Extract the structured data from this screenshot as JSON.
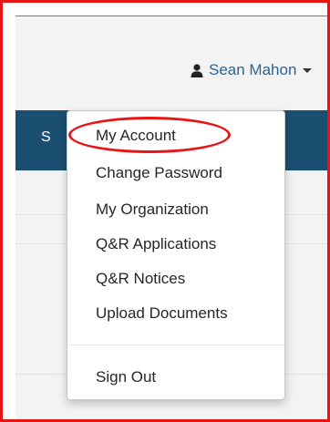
{
  "header": {
    "user_name": "Sean Mahon",
    "navbar_fragment": "S"
  },
  "icons": {
    "user": "user-icon",
    "caret": "chevron-down-icon"
  },
  "dropdown": {
    "items": [
      {
        "label": "My Account"
      },
      {
        "label": "Change Password"
      },
      {
        "label": "My Organization"
      },
      {
        "label": "Q&R Applications"
      },
      {
        "label": "Q&R Notices"
      },
      {
        "label": "Upload Documents"
      }
    ],
    "sign_out": "Sign Out"
  },
  "colors": {
    "annotation_red": "#e81515",
    "navbar_blue": "#1b4f72",
    "link_blue": "#2a6496"
  }
}
